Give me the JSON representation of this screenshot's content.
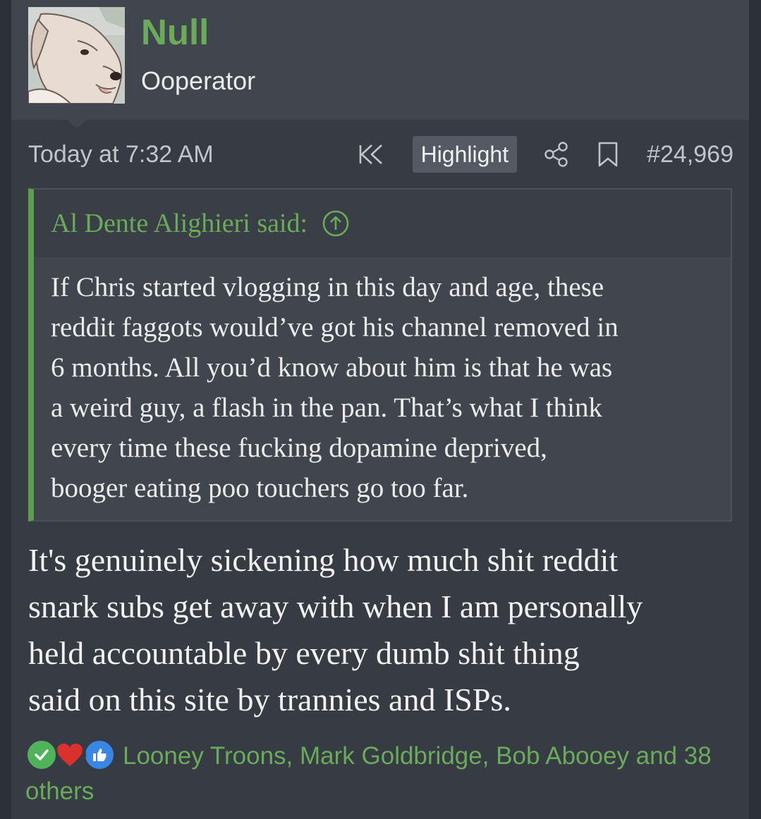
{
  "user": {
    "name": "Null",
    "title": "Ooperator"
  },
  "meta": {
    "time": "Today at 7:32 AM",
    "highlight_label": "Highlight",
    "post_number": "#24,969"
  },
  "quote": {
    "author": "Al Dente Alighieri said:",
    "text": "If Chris started vlogging in this day and age, these\nreddit faggots would’ve got his channel removed in\n6 months. All you’d know about him is that he was\na weird guy, a flash in the pan. That’s what I think\nevery time these fucking dopamine deprived,\nbooger eating poo touchers go too far."
  },
  "message": {
    "text": "It's genuinely sickening how much shit reddit\nsnark subs get away with when I am personally\nheld accountable by every dumb shit thing\nsaid on this site by trannies and ISPs."
  },
  "reactions": {
    "icons": [
      "check-icon",
      "heart-icon",
      "thumbs-up-icon"
    ],
    "text": "Looney Troons, Mark Goldbridge, Bob Abooey and 38 others"
  },
  "colors": {
    "accent_green": "#6aab5a",
    "background": "#363b44",
    "header_bg": "#40454e"
  }
}
